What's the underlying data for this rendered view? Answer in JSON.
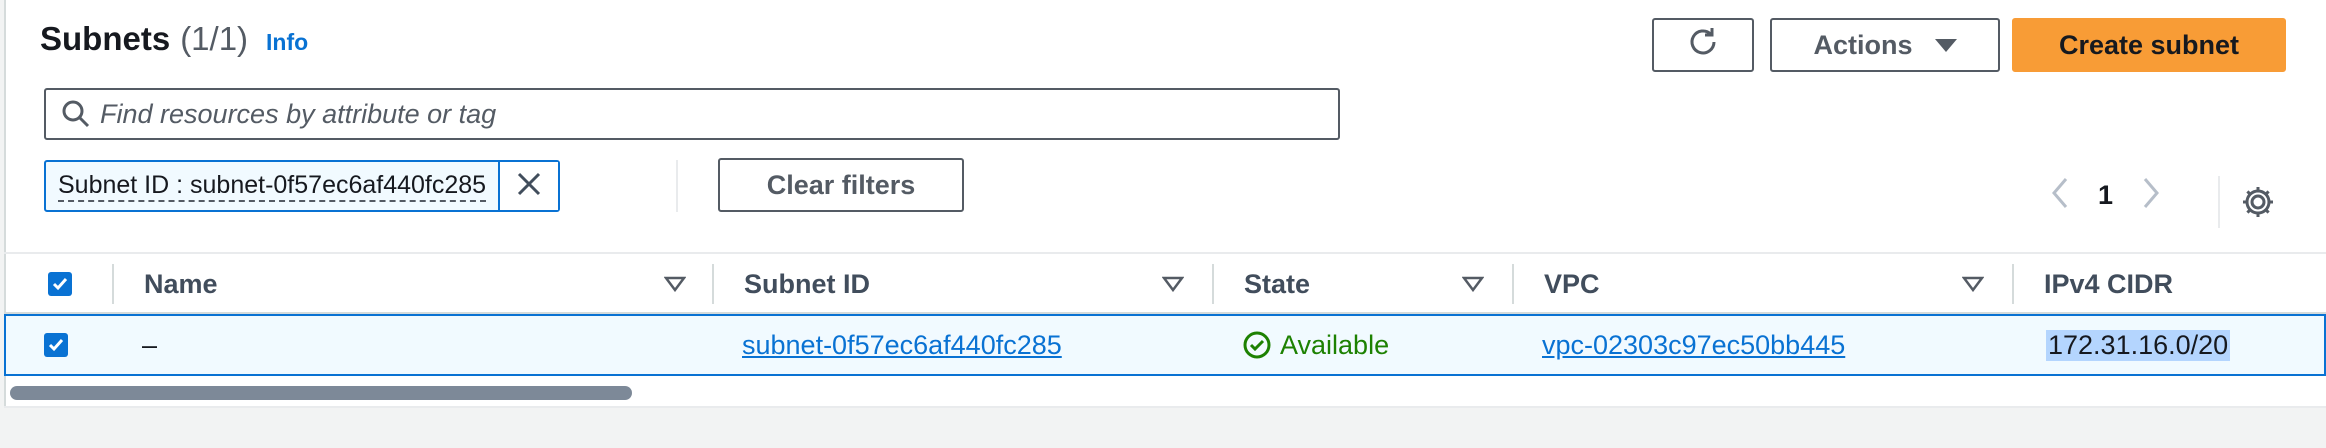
{
  "header": {
    "title": "Subnets",
    "count": "(1/1)",
    "info": "Info",
    "actions_label": "Actions",
    "create_label": "Create subnet"
  },
  "search": {
    "placeholder": "Find resources by attribute or tag"
  },
  "filter": {
    "token": "Subnet ID : subnet-0f57ec6af440fc285",
    "clear_label": "Clear filters"
  },
  "pagination": {
    "current_page": "1"
  },
  "table": {
    "columns": [
      "Name",
      "Subnet ID",
      "State",
      "VPC",
      "IPv4 CIDR"
    ],
    "rows": [
      {
        "selected": true,
        "name": "–",
        "subnet_id": "subnet-0f57ec6af440fc285",
        "state": "Available",
        "vpc": "vpc-02303c97ec50bb445",
        "ipv4_cidr": "172.31.16.0/20"
      }
    ]
  },
  "colors": {
    "primary": "#f89c36",
    "link": "#0972d3",
    "success": "#1d8102"
  },
  "icons": [
    "refresh-icon",
    "caret-down-icon",
    "search-icon",
    "close-icon",
    "chevron-left-icon",
    "chevron-right-icon",
    "gear-icon",
    "sort-icon",
    "check-circle-icon"
  ]
}
